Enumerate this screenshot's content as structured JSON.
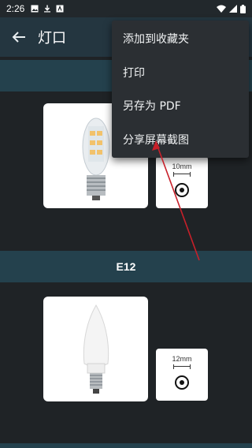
{
  "status_bar": {
    "time": "2:26",
    "left_icons": [
      "image-icon",
      "download-icon",
      "app-icon"
    ],
    "right_icons": [
      "wifi-icon",
      "signal-icon",
      "battery-icon"
    ]
  },
  "app_bar": {
    "back_icon": "arrow-left-icon",
    "title": "灯口"
  },
  "sections": [
    {
      "title": "",
      "dimension_label": "10mm"
    },
    {
      "title": "E12",
      "dimension_label": "12mm"
    }
  ],
  "menu": {
    "items": [
      "添加到收藏夹",
      "打印",
      "另存为 PDF",
      "分享屏幕截图"
    ]
  },
  "colors": {
    "app_bar": "#243640",
    "section_header": "#24414d",
    "background": "#1f2326",
    "menu_background": "#2b2f33",
    "annotation_arrow": "#c8202a"
  }
}
